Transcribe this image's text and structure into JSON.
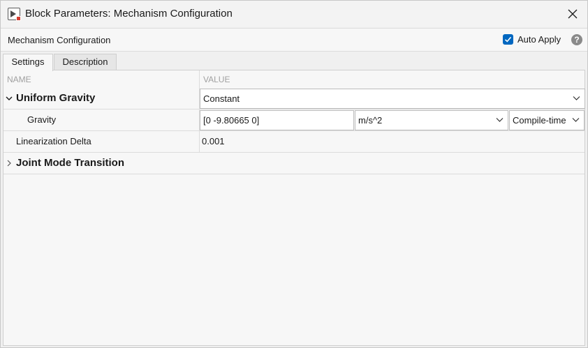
{
  "window": {
    "title": "Block Parameters: Mechanism Configuration",
    "icon": "simulink-block-icon",
    "close_icon": "close-icon"
  },
  "header": {
    "title": "Mechanism Configuration",
    "auto_apply_label": "Auto Apply",
    "auto_apply_checked": true,
    "help_icon": "help-icon",
    "help_glyph": "?"
  },
  "tabs": [
    {
      "label": "Settings",
      "active": true
    },
    {
      "label": "Description",
      "active": false
    }
  ],
  "table": {
    "name_header": "NAME",
    "value_header": "VALUE",
    "uniform_gravity": {
      "label": "Uniform Gravity",
      "expanded": true,
      "value": "Constant"
    },
    "gravity": {
      "label": "Gravity",
      "value": "[0 -9.80665 0]",
      "unit": "m/s^2",
      "mode": "Compile-time"
    },
    "linearization_delta": {
      "label": "Linearization Delta",
      "value": "0.001"
    },
    "joint_mode_transition": {
      "label": "Joint Mode Transition",
      "expanded": false
    }
  },
  "colors": {
    "accent": "#0067c0",
    "border": "#cfcfcf",
    "background": "#f7f7f7"
  }
}
